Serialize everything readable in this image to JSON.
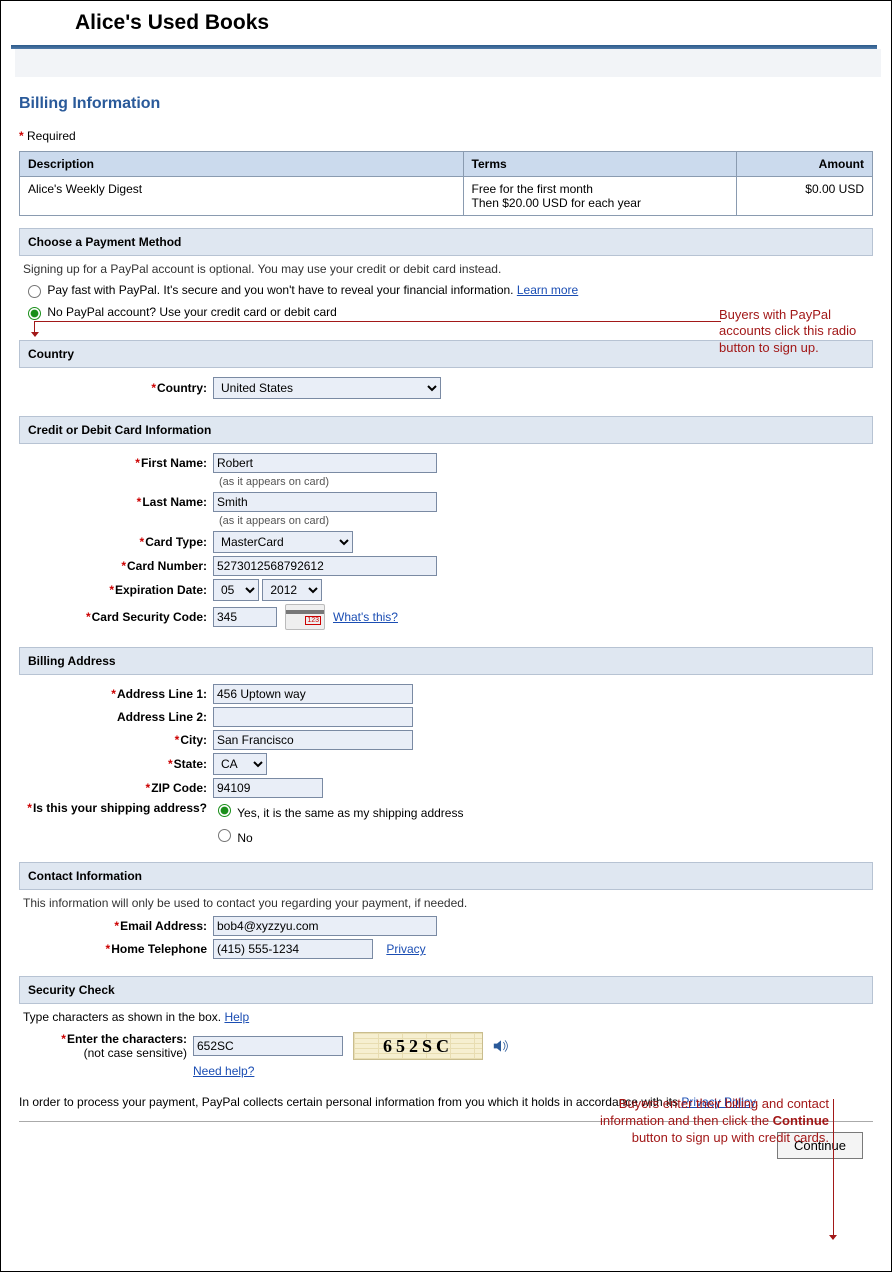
{
  "shop_title": "Alice's Used Books",
  "page_heading": "Billing Information",
  "required_label": "Required",
  "order": {
    "cols": {
      "desc": "Description",
      "terms": "Terms",
      "amount": "Amount"
    },
    "desc": "Alice's Weekly Digest",
    "terms_l1": "Free for the first month",
    "terms_l2": "Then $20.00 USD for each year",
    "amount": "$0.00 USD"
  },
  "pay_method": {
    "title": "Choose a Payment Method",
    "note": "Signing up for a PayPal account is optional. You may use your credit or debit card instead.",
    "opt1": "Pay fast with PayPal. It's secure and you won't have to reveal your financial information.",
    "opt1_link": "Learn more",
    "opt2": "No PayPal account? Use your credit card or debit card"
  },
  "country_sec": {
    "title": "Country",
    "label": "Country:",
    "value": "United States"
  },
  "card_sec": {
    "title": "Credit or Debit Card Information",
    "first_name_lbl": "First Name:",
    "first_name": "Robert",
    "first_hint": "(as it appears on card)",
    "last_name_lbl": "Last Name:",
    "last_name": "Smith",
    "last_hint": "(as it appears on card)",
    "type_lbl": "Card Type:",
    "type": "MasterCard",
    "num_lbl": "Card Number:",
    "num": "5273012568792612",
    "exp_lbl": "Expiration Date:",
    "exp_mm": "05",
    "exp_yy": "2012",
    "csc_lbl": "Card Security Code:",
    "csc": "345",
    "csc_link": "What's this?"
  },
  "bill_sec": {
    "title": "Billing Address",
    "addr1_lbl": "Address Line 1:",
    "addr1": "456 Uptown way",
    "addr2_lbl": "Address Line 2:",
    "addr2": "",
    "city_lbl": "City:",
    "city": "San Francisco",
    "state_lbl": "State:",
    "state": "CA",
    "zip_lbl": "ZIP Code:",
    "zip": "94109",
    "ship_q": "Is this your shipping address?",
    "ship_yes": "Yes, it is the same as my shipping address",
    "ship_no": "No"
  },
  "contact_sec": {
    "title": "Contact Information",
    "note": "This information will only be used to contact you regarding your payment, if needed.",
    "email_lbl": "Email Address:",
    "email": "bob4@xyzzyu.com",
    "phone_lbl": "Home Telephone",
    "phone": "(415) 555-1234",
    "privacy": "Privacy"
  },
  "sec_check": {
    "title": "Security Check",
    "note": "Type characters as shown in the box.",
    "help": "Help",
    "enter_lbl": "Enter the characters:",
    "hint": "(not case sensitive)",
    "value": "652SC",
    "captcha": "652SC",
    "need_help": "Need help?"
  },
  "policy_prefix": "In order to process your payment, PayPal collects certain personal information from you which it holds in accordance with its ",
  "policy_link": "Privacy Policy",
  "policy_suffix": ".",
  "continue": "Continue",
  "annotation1": "Buyers with PayPal accounts click this radio button to sign up.",
  "annotation2_pre": "Buyers enter their billing and contact information and then click the ",
  "annotation2_bold": "Continue",
  "annotation2_post": " button to sign up with credit cards."
}
